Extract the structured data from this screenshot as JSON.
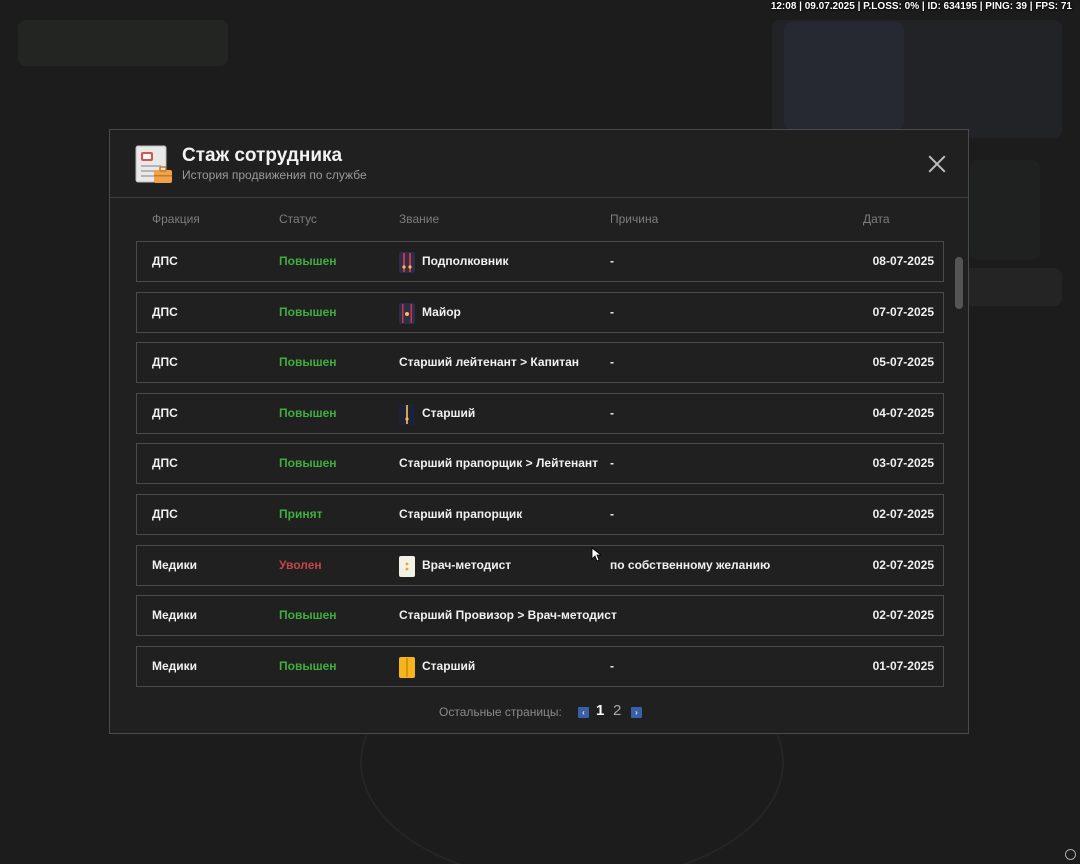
{
  "status_bar": "12:08 | 09.07.2025 | P.LOSS: 0% | ID: 634195 | PING: 39 | FPS: 71",
  "modal": {
    "title": "Стаж сотрудника",
    "subtitle": "История продвижения по службе",
    "icon": "document-badge-icon",
    "close_icon": "close-icon"
  },
  "columns": {
    "fraction": "Фракция",
    "status": "Статус",
    "rank": "Звание",
    "reason": "Причина",
    "date": "Дата"
  },
  "colors": {
    "promoted": "#3fae3f",
    "fired": "#c64545",
    "pager_arrow": "#3b5fa7"
  },
  "rows": [
    {
      "fraction": "ДПС",
      "status": "Повышен",
      "status_type": "promoted",
      "rank": "Подполковник",
      "rank_icon": "shoulder-strap-two-stripes-icon",
      "reason": "-",
      "date": "08-07-2025"
    },
    {
      "fraction": "ДПС",
      "status": "Повышен",
      "status_type": "promoted",
      "rank": "Майор",
      "rank_icon": "shoulder-strap-one-star-icon",
      "reason": "-",
      "date": "07-07-2025"
    },
    {
      "fraction": "ДПС",
      "status": "Повышен",
      "status_type": "promoted",
      "rank": "Старший лейтенант > Капитан",
      "rank_icon": "",
      "reason": "-",
      "date": "05-07-2025"
    },
    {
      "fraction": "ДПС",
      "status": "Повышен",
      "status_type": "promoted",
      "rank": "Старший",
      "rank_icon": "shoulder-strap-dark-icon",
      "reason": "-",
      "date": "04-07-2025"
    },
    {
      "fraction": "ДПС",
      "status": "Повышен",
      "status_type": "promoted",
      "rank": "Старший прапорщик > Лейтенант",
      "rank_icon": "",
      "reason": "-",
      "date": "03-07-2025"
    },
    {
      "fraction": "ДПС",
      "status": "Принят",
      "status_type": "promoted",
      "rank": "Старший прапорщик",
      "rank_icon": "",
      "reason": "-",
      "date": "02-07-2025"
    },
    {
      "fraction": "Медики",
      "status": "Уволен",
      "status_type": "fired",
      "rank": "Врач-методист",
      "rank_icon": "shoulder-strap-white-icon",
      "reason": "по собственному желанию",
      "date": "02-07-2025"
    },
    {
      "fraction": "Медики",
      "status": "Повышен",
      "status_type": "promoted",
      "rank": "Старший Провизор > Врач-методист",
      "rank_icon": "",
      "reason": "",
      "date": "02-07-2025"
    },
    {
      "fraction": "Медики",
      "status": "Повышен",
      "status_type": "promoted",
      "rank": "Старший",
      "rank_icon": "shoulder-strap-yellow-icon",
      "reason": "-",
      "date": "01-07-2025"
    }
  ],
  "pager": {
    "label": "Остальные страницы:",
    "pages": [
      "1",
      "2"
    ],
    "current": "1"
  }
}
